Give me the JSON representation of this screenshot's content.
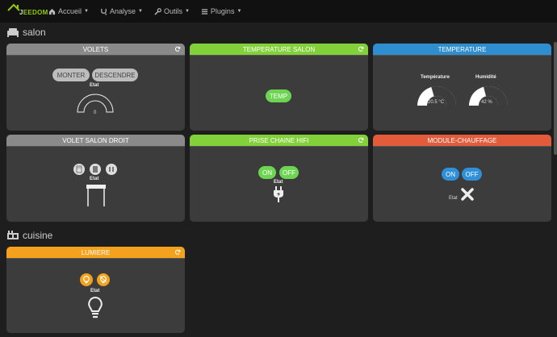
{
  "navbar": {
    "brand_prefix": "J",
    "brand_name": "EEDOM",
    "menu": [
      {
        "label": "Accueil",
        "icon": "home-icon"
      },
      {
        "label": "Analyse",
        "icon": "stethoscope-icon"
      },
      {
        "label": "Outils",
        "icon": "wrench-icon"
      },
      {
        "label": "Plugins",
        "icon": "list-icon"
      }
    ]
  },
  "salon": {
    "title": "salon",
    "volets": {
      "title": "VOLETS",
      "btn_up": "MONTER",
      "btn_down": "DESCENDRE",
      "state_label": "Etat",
      "state_value": "0"
    },
    "temp_salon": {
      "title": "TEMPERATURE SALON",
      "btn": "TEMP"
    },
    "temperature": {
      "title": "TEMPERATURE",
      "temp_label": "Température",
      "temp_value": "20.5 °C",
      "temp_fraction": 0.41,
      "hum_label": "Humidité",
      "hum_value": "42 %",
      "hum_fraction": 0.42
    },
    "volet_droit": {
      "title": "VOLET SALON DROIT",
      "state_label": "Etat"
    },
    "prise": {
      "title": "PRISE CHAINE HIFI",
      "on": "ON",
      "off": "OFF",
      "state_label": "Etat"
    },
    "chauffage": {
      "title": "MODULE-CHAUFFAGE",
      "on": "ON",
      "off": "OFF",
      "state_label": "Etat"
    }
  },
  "cuisine": {
    "title": "cuisine",
    "lumiere": {
      "title": "LUMIERE",
      "state_label": "Etat"
    }
  },
  "colors": {
    "grey": "#8a8a8a",
    "green": "#83d13a",
    "blue": "#2f8ecf",
    "red": "#e25c3b",
    "orange": "#f4a11d"
  }
}
